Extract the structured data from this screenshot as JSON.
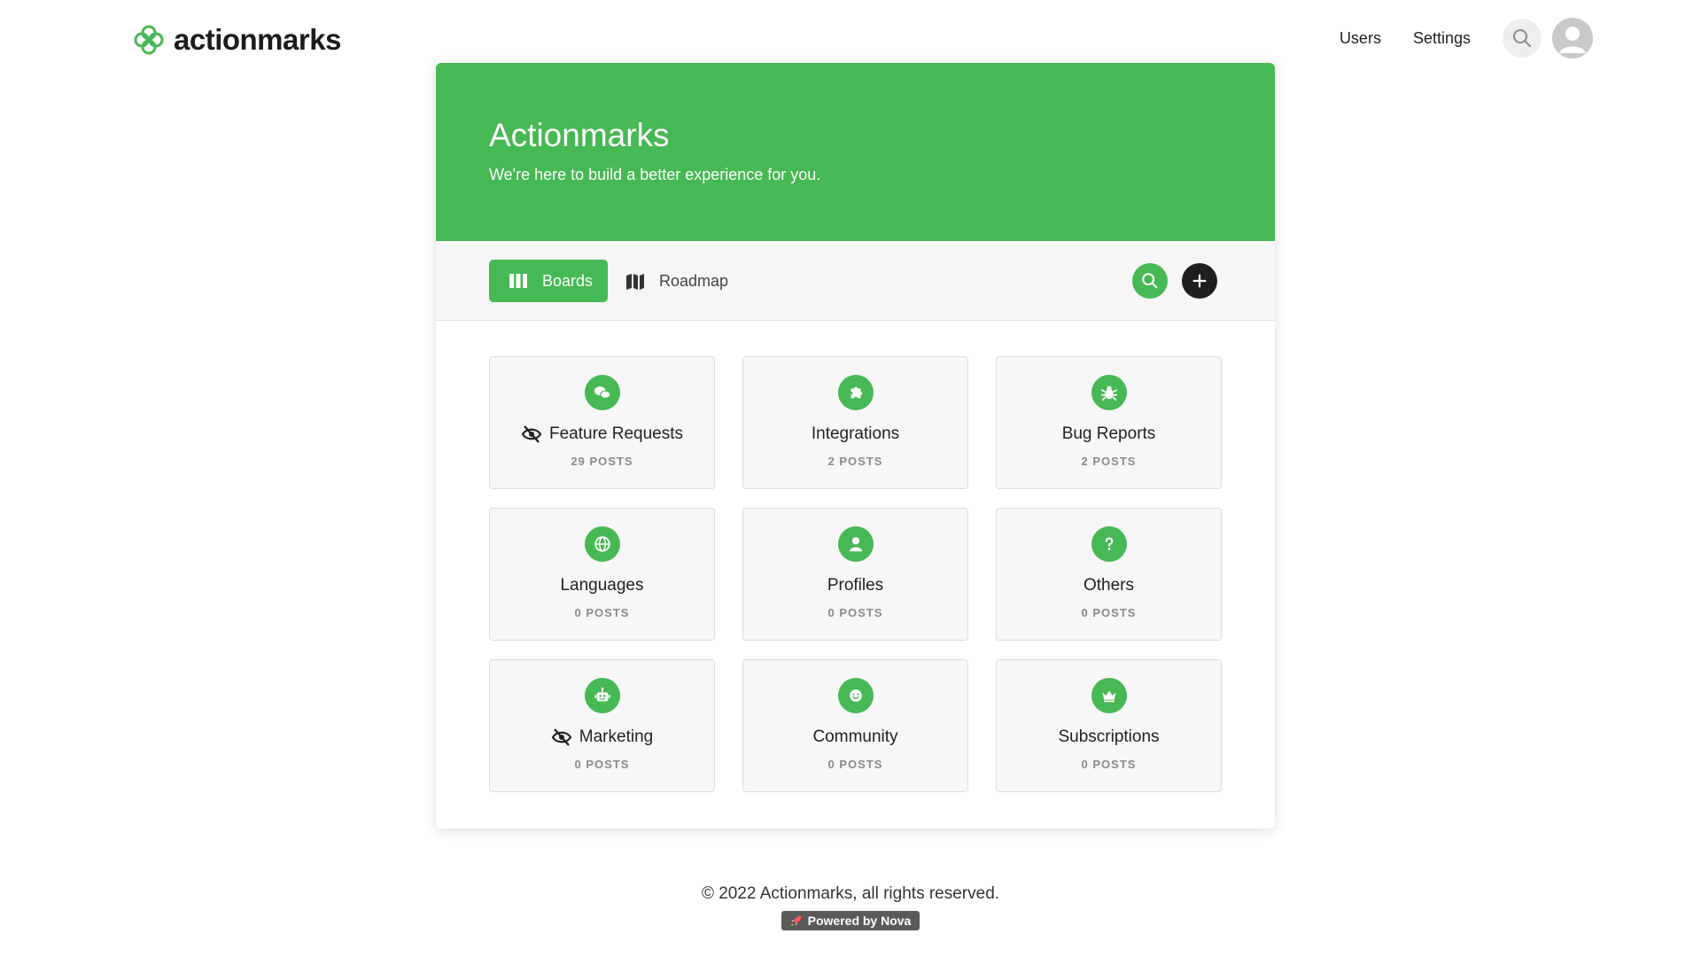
{
  "brand": {
    "name": "actionmarks",
    "accent": "#46b854",
    "logo_icon": "flower-logo-icon"
  },
  "topnav": {
    "links": [
      "Users",
      "Settings"
    ],
    "search_icon": "search-icon",
    "avatar_icon": "user-avatar-icon"
  },
  "hero": {
    "title": "Actionmarks",
    "subtitle": "We're here to build a better experience for you."
  },
  "toolbar": {
    "tabs": [
      {
        "label": "Boards",
        "icon": "columns-icon",
        "active": true
      },
      {
        "label": "Roadmap",
        "icon": "map-icon",
        "active": false
      }
    ],
    "search_icon": "search-icon",
    "add_icon": "plus-icon"
  },
  "boards": [
    {
      "name": "Feature Requests",
      "count": "29 POSTS",
      "icon": "chat-bubbles-icon",
      "hidden": true
    },
    {
      "name": "Integrations",
      "count": "2 POSTS",
      "icon": "puzzle-icon",
      "hidden": false
    },
    {
      "name": "Bug Reports",
      "count": "2 POSTS",
      "icon": "bug-icon",
      "hidden": false
    },
    {
      "name": "Languages",
      "count": "0 POSTS",
      "icon": "globe-icon",
      "hidden": false
    },
    {
      "name": "Profiles",
      "count": "0 POSTS",
      "icon": "user-icon",
      "hidden": false
    },
    {
      "name": "Others",
      "count": "0 POSTS",
      "icon": "question-icon",
      "hidden": false
    },
    {
      "name": "Marketing",
      "count": "0 POSTS",
      "icon": "robot-icon",
      "hidden": true
    },
    {
      "name": "Community",
      "count": "0 POSTS",
      "icon": "smile-icon",
      "hidden": false
    },
    {
      "name": "Subscriptions",
      "count": "0 POSTS",
      "icon": "crown-icon",
      "hidden": false
    }
  ],
  "footer": {
    "copyright": "© 2022 Actionmarks, all rights reserved.",
    "powered_by": "Powered by Nova",
    "powered_icon": "rocket-icon"
  }
}
